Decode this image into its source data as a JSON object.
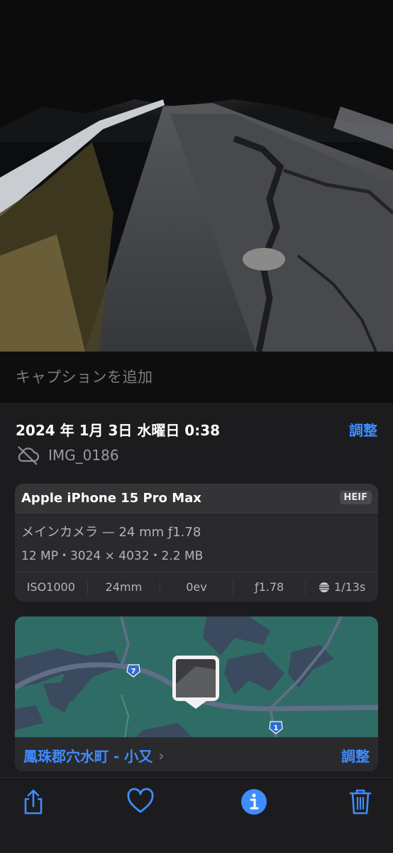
{
  "photo": {
    "description_icon": "photo-thumbnail"
  },
  "caption": {
    "placeholder": "キャプションを追加"
  },
  "info": {
    "date": "2024 年 1月 3日 水曜日 0:38",
    "adjust_label": "調整",
    "file_name": "IMG_0186",
    "cloud_icon": "cloud-off-icon"
  },
  "camera": {
    "device": "Apple iPhone 15 Pro Max",
    "format": "HEIF",
    "lens": "メインカメラ — 24 mm ƒ1.78",
    "specs": "12 MP・3024 × 4032・2.2 MB",
    "exif": [
      {
        "name": "iso",
        "label": "ISO1000"
      },
      {
        "name": "focal",
        "label": "24mm"
      },
      {
        "name": "ev",
        "label": "0ev"
      },
      {
        "name": "aperture",
        "label": "ƒ1.78"
      },
      {
        "name": "shutter",
        "label": "1/13s"
      }
    ]
  },
  "map": {
    "route_labels": [
      "7",
      "1"
    ],
    "location": "鳳珠郡穴水町 - 小又",
    "adjust_label": "調整"
  },
  "toolbar": {
    "share_icon": "share-icon",
    "favorite_icon": "heart-icon",
    "info_icon": "info-icon",
    "delete_icon": "trash-icon"
  },
  "colors": {
    "accent": "#3f8cff",
    "map_bg": "#2f6c66",
    "sheet": "#1c1c1e"
  }
}
